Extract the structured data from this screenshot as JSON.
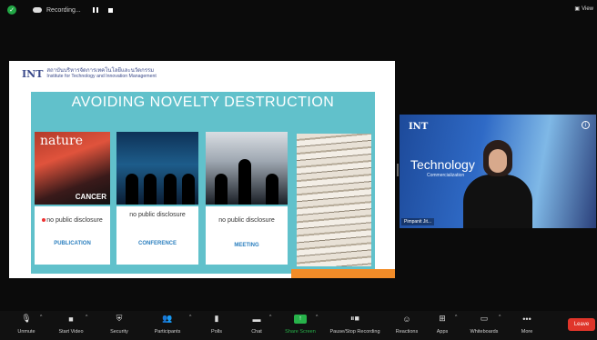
{
  "topbar": {
    "recording_label": "Recording...",
    "view_label": "View"
  },
  "slide": {
    "header": {
      "logo": "INT",
      "institute_th": "สถาบันบริหารจัดการเทคโนโลยีและนวัตกรรม",
      "institute_en": "Institute for Technology and Innovation Management"
    },
    "title": "AVOIDING NOVELTY DESTRUCTION",
    "cards": [
      {
        "disclosure": "no public disclosure",
        "label": "PUBLICATION"
      },
      {
        "disclosure": "no public disclosure",
        "label": "CONFERENCE"
      },
      {
        "disclosure": "no public disclosure",
        "label": "MEETING"
      }
    ],
    "nature_text": "nature",
    "cancer_text": "CANCER"
  },
  "video": {
    "logo": "INT",
    "title": "Technology",
    "subtitle": "Commercialization",
    "name": "Pimpanit Jit..."
  },
  "toolbar": {
    "items": [
      {
        "label": "Unmute",
        "icon": "mic-muted-icon"
      },
      {
        "label": "Start Video",
        "icon": "video-off-icon"
      },
      {
        "label": "Security",
        "icon": "shield-icon"
      },
      {
        "label": "Participants",
        "icon": "participants-icon",
        "count": "3"
      },
      {
        "label": "Polls",
        "icon": "polls-icon"
      },
      {
        "label": "Chat",
        "icon": "chat-icon"
      },
      {
        "label": "Share Screen",
        "icon": "share-screen-icon"
      },
      {
        "label": "Pause/Stop Recording",
        "icon": "pause-stop-icon"
      },
      {
        "label": "Reactions",
        "icon": "reactions-icon"
      },
      {
        "label": "Apps",
        "icon": "apps-icon"
      },
      {
        "label": "Whiteboards",
        "icon": "whiteboard-icon"
      },
      {
        "label": "More",
        "icon": "more-icon"
      }
    ],
    "leave_label": "Leave",
    "accent": "#27b24a",
    "leave_color": "#e0352a"
  }
}
